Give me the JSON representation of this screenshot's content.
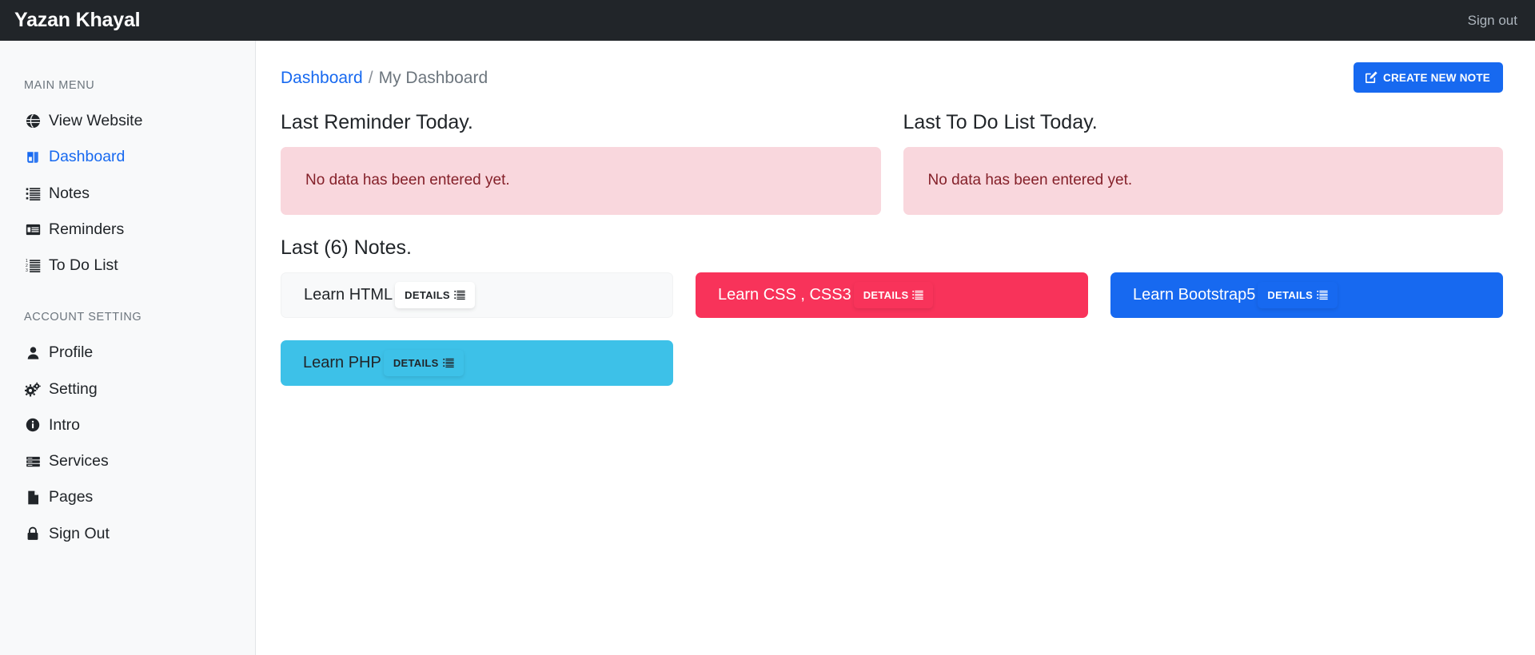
{
  "topbar": {
    "brand": "Yazan Khayal",
    "signout_label": "Sign out"
  },
  "sidebar": {
    "main_menu_heading": "MAIN MENU",
    "account_setting_heading": "ACCOUNT SETTING",
    "main_items": [
      {
        "label": "View Website",
        "icon": "globe-icon",
        "active": false
      },
      {
        "label": "Dashboard",
        "icon": "dashboard-icon",
        "active": true
      },
      {
        "label": "Notes",
        "icon": "list-ul-icon",
        "active": false
      },
      {
        "label": "Reminders",
        "icon": "window-list-icon",
        "active": false
      },
      {
        "label": "To Do List",
        "icon": "list-ol-icon",
        "active": false
      }
    ],
    "account_items": [
      {
        "label": "Profile",
        "icon": "user-icon",
        "active": false
      },
      {
        "label": "Setting",
        "icon": "gears-icon",
        "active": false
      },
      {
        "label": "Intro",
        "icon": "info-circle-icon",
        "active": false
      },
      {
        "label": "Services",
        "icon": "server-icon",
        "active": false
      },
      {
        "label": "Pages",
        "icon": "file-icon",
        "active": false
      },
      {
        "label": "Sign Out",
        "icon": "lock-icon",
        "active": false
      }
    ]
  },
  "breadcrumb": {
    "root_label": "Dashboard",
    "separator": "/",
    "current_label": "My Dashboard"
  },
  "toolbar": {
    "create_note_label": "CREATE NEW NOTE",
    "create_note_icon": "edit-pencil-icon"
  },
  "panels": [
    {
      "title": "Last Reminder Today.",
      "alert_text": "No data has been entered yet.",
      "alert_type": "danger"
    },
    {
      "title": "Last To Do List Today.",
      "alert_text": "No data has been entered yet.",
      "alert_type": "danger"
    }
  ],
  "notes_section": {
    "title": "Last (6) Notes.",
    "details_label": "DETAILS",
    "details_icon": "list-icon",
    "notes": [
      {
        "title": "Learn HTML",
        "variant": "light"
      },
      {
        "title": "Learn CSS , CSS3",
        "variant": "danger"
      },
      {
        "title": "Learn Bootstrap5",
        "variant": "primary"
      },
      {
        "title": "Learn PHP",
        "variant": "info"
      }
    ]
  },
  "colors": {
    "topbar_bg": "#212529",
    "sidebar_bg": "#f8f9fa",
    "accent_primary": "#1769f0",
    "accent_danger": "#f8335a",
    "accent_info": "#3dc1e8",
    "alert_bg": "#f9d7dd",
    "alert_text": "#842029",
    "muted_text": "#6c757d"
  }
}
